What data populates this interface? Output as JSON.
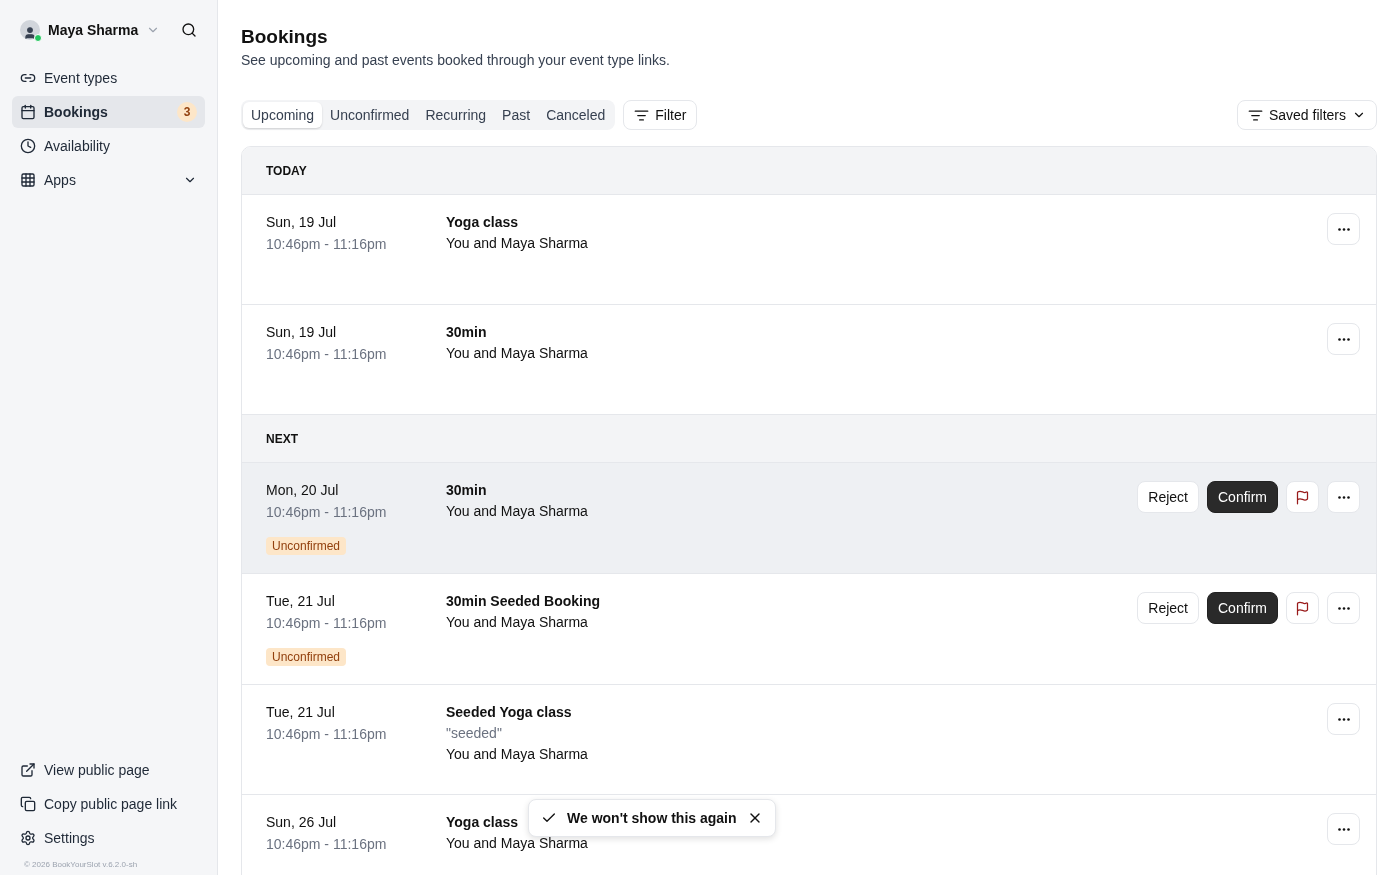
{
  "sidebar": {
    "user": {
      "name": "Maya Sharma",
      "online": true
    },
    "items": [
      {
        "label": "Event types",
        "selected": false
      },
      {
        "label": "Bookings",
        "selected": true,
        "badge": "3"
      },
      {
        "label": "Availability",
        "selected": false
      },
      {
        "label": "Apps",
        "selected": false,
        "expandable": true
      }
    ],
    "footer_items": [
      {
        "label": "View public page"
      },
      {
        "label": "Copy public page link"
      },
      {
        "label": "Settings"
      }
    ],
    "copyright": "© 2026 BookYourSlot v.6.2.0-sh"
  },
  "page": {
    "title": "Bookings",
    "subtitle": "See upcoming and past events booked through your event type links."
  },
  "tabs": [
    {
      "label": "Upcoming",
      "selected": true
    },
    {
      "label": "Unconfirmed",
      "selected": false
    },
    {
      "label": "Recurring",
      "selected": false
    },
    {
      "label": "Past",
      "selected": false
    },
    {
      "label": "Canceled",
      "selected": false
    }
  ],
  "filter_button": "Filter",
  "saved_filters_button": "Saved filters",
  "sections": [
    {
      "heading": "TODAY",
      "bookings": [
        {
          "date": "Sun, 19 Jul",
          "time": "10:46pm - 11:16pm",
          "title": "Yoga class",
          "attendees": "You and Maya Sharma",
          "highlighted": false
        },
        {
          "date": "Sun, 19 Jul",
          "time": "10:46pm - 11:16pm",
          "title": "30min",
          "attendees": "You and Maya Sharma",
          "highlighted": false
        }
      ]
    },
    {
      "heading": "NEXT",
      "bookings": [
        {
          "date": "Mon, 20 Jul",
          "time": "10:46pm - 11:16pm",
          "title": "30min",
          "attendees": "You and Maya Sharma",
          "status": "Unconfirmed",
          "reject": "Reject",
          "confirm": "Confirm",
          "highlighted": true
        },
        {
          "date": "Tue, 21 Jul",
          "time": "10:46pm - 11:16pm",
          "title": "30min Seeded Booking",
          "attendees": "You and Maya Sharma",
          "status": "Unconfirmed",
          "reject": "Reject",
          "confirm": "Confirm",
          "highlighted": false
        },
        {
          "date": "Tue, 21 Jul",
          "time": "10:46pm - 11:16pm",
          "title": "Seeded Yoga class",
          "note": "\"seeded\"",
          "attendees": "You and Maya Sharma",
          "highlighted": false
        },
        {
          "date": "Sun, 26 Jul",
          "time": "10:46pm - 11:16pm",
          "title": "Yoga class",
          "attendees": "You and Maya Sharma",
          "highlighted": false
        }
      ]
    }
  ],
  "toast": {
    "message": "We won't show this again"
  }
}
